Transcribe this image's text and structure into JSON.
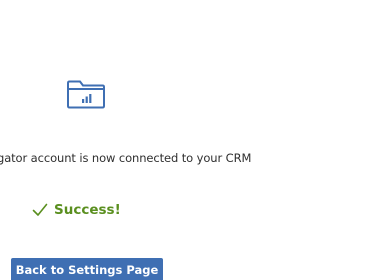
{
  "icons": {
    "folder": "folder-chart-icon",
    "success": "checkmark-icon"
  },
  "colors": {
    "icon_blue": "#3f6fb3",
    "success_green": "#5a8f1f",
    "button_bg": "#3f6fb3",
    "button_text": "#ffffff"
  },
  "status": {
    "message": "gator account is now connected to your CRM",
    "success_label": "Success!"
  },
  "actions": {
    "back_label": "Back to Settings Page"
  }
}
